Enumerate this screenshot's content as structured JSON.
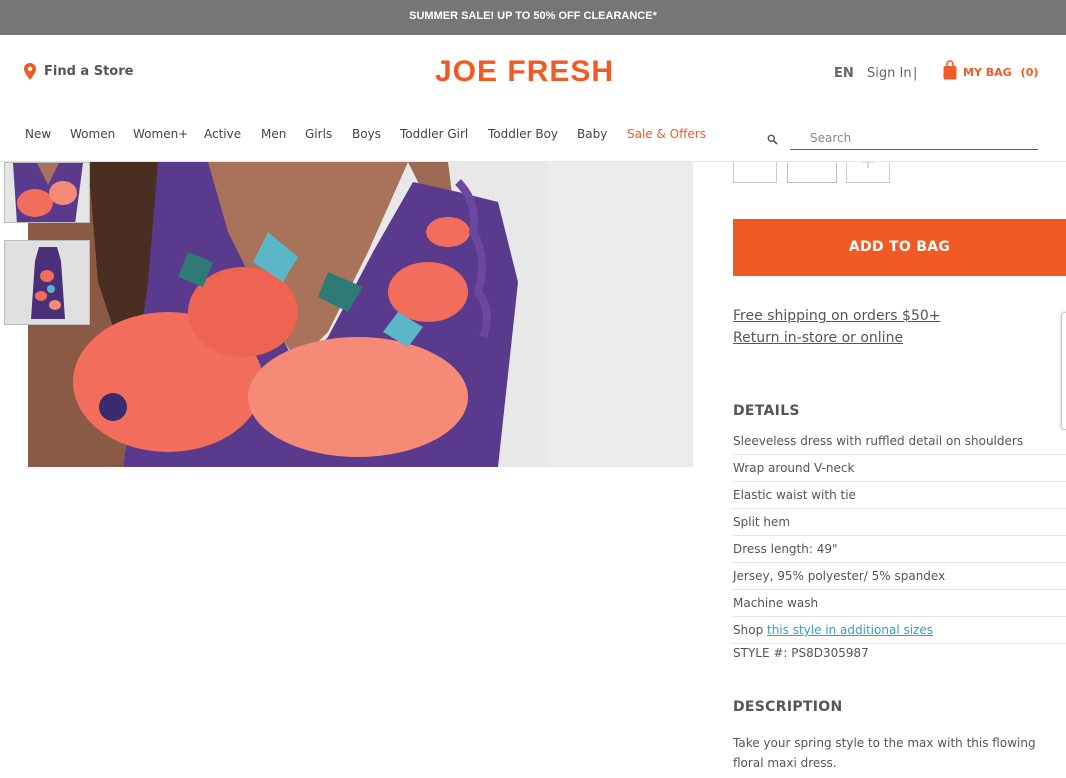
{
  "promo": {
    "text": "SUMMER SALE! UP TO 50% OFF CLEARANCE*"
  },
  "header": {
    "find_store": "Find a Store",
    "logo": "JOE FRESH",
    "lang": "EN",
    "sign_in": "Sign In",
    "separator": "|",
    "bag_label": "MY BAG",
    "bag_count": "(0)"
  },
  "nav": {
    "items": [
      "New",
      "Women",
      "Women+",
      "Active",
      "Men",
      "Girls",
      "Boys",
      "Toddler Girl",
      "Toddler Boy",
      "Baby",
      "Sale & Offers"
    ]
  },
  "search": {
    "placeholder": "Search"
  },
  "product": {
    "qty_minus": "−",
    "qty_plus": "+",
    "add_to_bag": "ADD TO BAG",
    "shipping_link": "Free shipping on orders $50+",
    "return_link": "Return in-store or online",
    "details_title": "DETAILS",
    "details": [
      "Sleeveless dress with ruffled detail on shoulders",
      "Wrap around V-neck",
      "Elastic waist with tie",
      "Split hem",
      "Dress length: 49\"",
      "Jersey, 95% polyester/ 5% spandex",
      "Machine wash"
    ],
    "shop_prefix": "Shop ",
    "shop_link": "this style in additional sizes",
    "style_number": "STYLE #: PS8D305987",
    "description_title": "DESCRIPTION",
    "description": "Take your spring style to the max with this flowing floral maxi dress."
  },
  "colors": {
    "accent": "#f15a24",
    "promo_bg": "#767676",
    "link_blue": "#2aa3c5",
    "dress_purple": "#5a3a8c",
    "dress_coral": "#f26d5b"
  },
  "icons": {
    "store": "map-pin-icon",
    "bag": "shopping-bag-icon",
    "search": "search-icon"
  }
}
